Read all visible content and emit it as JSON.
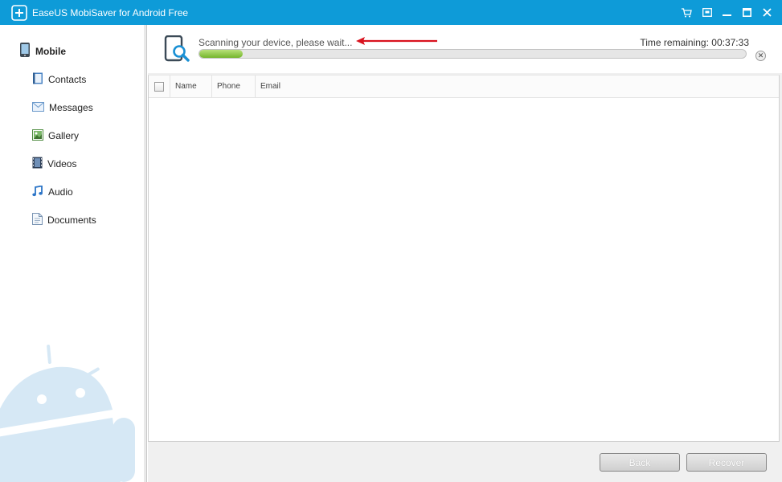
{
  "window": {
    "title": "EaseUS MobiSaver for Android Free",
    "controls": [
      "cart-icon",
      "restore-icon",
      "minimize-icon",
      "maximize-icon",
      "close-icon"
    ]
  },
  "sidebar": {
    "root_label": "Mobile",
    "items": [
      {
        "label": "Contacts",
        "icon": "contacts-icon"
      },
      {
        "label": "Messages",
        "icon": "messages-icon"
      },
      {
        "label": "Gallery",
        "icon": "gallery-icon"
      },
      {
        "label": "Videos",
        "icon": "videos-icon"
      },
      {
        "label": "Audio",
        "icon": "audio-icon"
      },
      {
        "label": "Documents",
        "icon": "documents-icon"
      }
    ]
  },
  "scan": {
    "status": "Scanning your device, please wait...",
    "time_remaining": "Time remaining: 00:37:33",
    "progress_fraction": 0.08
  },
  "table": {
    "columns": [
      "Name",
      "Phone",
      "Email"
    ]
  },
  "footer": {
    "back_label": "Back",
    "recover_label": "Recover"
  },
  "colors": {
    "titlebar": "#0e9bd8",
    "progress": "#8cc63f",
    "annotation_arrow": "#d9121e"
  }
}
